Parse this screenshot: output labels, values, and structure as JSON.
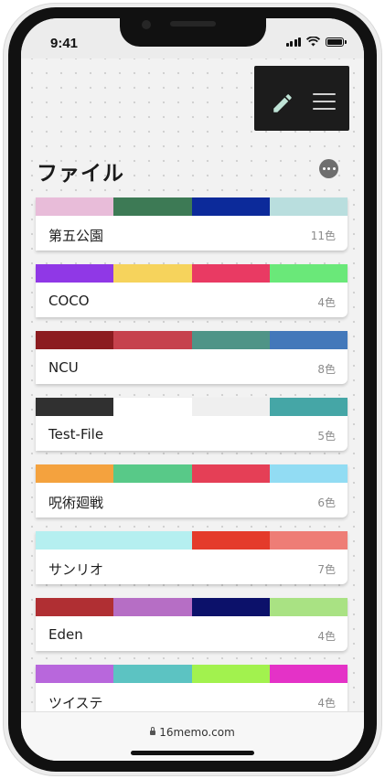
{
  "status_bar": {
    "time": "9:41"
  },
  "header": {
    "title": "ファイル"
  },
  "files": [
    {
      "name": "第五公園",
      "count": "11色",
      "colors": [
        "#e8bcd9",
        "#3d7a55",
        "#0c2a9a",
        "#b9dede"
      ]
    },
    {
      "name": "COCO",
      "count": "4色",
      "colors": [
        "#9038e6",
        "#f6d35c",
        "#e93a63",
        "#6ae879"
      ]
    },
    {
      "name": "NCU",
      "count": "8色",
      "colors": [
        "#8c1c20",
        "#c6424d",
        "#4f9487",
        "#4378ba"
      ]
    },
    {
      "name": "Test-File",
      "count": "5色",
      "colors": [
        "#303030",
        "#ffffff",
        "#efefef",
        "#45a6a6"
      ]
    },
    {
      "name": "呪術廻戦",
      "count": "6色",
      "colors": [
        "#f4a23e",
        "#58c988",
        "#e53f56",
        "#92dcf3"
      ]
    },
    {
      "name": "サンリオ",
      "count": "7色",
      "colors": [
        "#b5eff0",
        "#b5eff0",
        "#e43b2b",
        "#ee7d76"
      ]
    },
    {
      "name": "Eden",
      "count": "4色",
      "colors": [
        "#b02f33",
        "#b66ec5",
        "#0c116a",
        "#a9e283"
      ]
    },
    {
      "name": "ツイステ",
      "count": "4色",
      "colors": [
        "#b867dc",
        "#5cc3c2",
        "#a2f24e",
        "#e432c7"
      ]
    }
  ],
  "browser": {
    "url": "16memo.com"
  },
  "icons": {
    "edit": "pencil-icon",
    "menu": "hamburger-menu-icon",
    "more": "more-horizontal-icon",
    "lock": "lock-icon"
  }
}
